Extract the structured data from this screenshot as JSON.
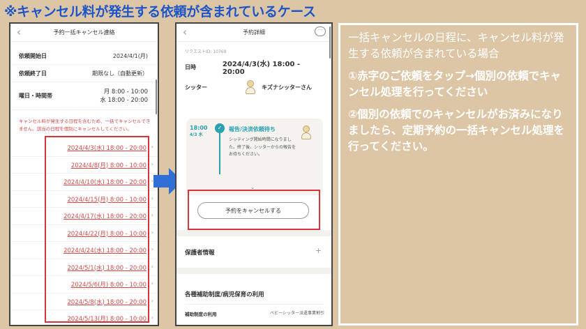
{
  "slide_title": "※キャンセル料が発生する依頼が含まれているケース",
  "left_screen": {
    "nav_title": "予約一括キャンセル連絡",
    "back_icon": "‹",
    "start_label": "依頼開始日",
    "start_value": "2024/4/1(月)",
    "end_label": "依頼終了日",
    "end_value": "期限なし（自動更新）",
    "schedule_label": "曜日・時間帯",
    "schedule_line1": "月 8:00 - 10:00",
    "schedule_line2": "水 18:00 - 20:00",
    "notice": "キャンセル料が発生する日程を含むため、一括でキャンセルできません。該当の日程を個別にキャンセルしてください。",
    "dates": [
      "2024/4/3(水) 18:00 - 20:00",
      "2024/4/8(月) 8:00 - 10:00",
      "2024/4/10(水) 18:00 - 20:00",
      "2024/4/15(月) 8:00 - 10:00",
      "2024/4/17(水) 18:00 - 20:00",
      "2024/4/22(月) 8:00 - 10:00",
      "2024/4/24(水) 18:00 - 20:00",
      "2024/5/1(水) 18:00 - 20:00",
      "2024/5/6(月) 8:00 - 10:00",
      "2024/5/8(水) 18:00 - 20:00",
      "2024/5/13(月) 8:00 - 10:00"
    ],
    "chevron": "›"
  },
  "right_screen": {
    "nav_title": "予約詳細",
    "back_icon": "‹",
    "chat_icon": "···",
    "request_id": "リクエストID: 10769",
    "datetime_label": "日時",
    "datetime_value": "2024/4/3(水) 18:00 - 20:00",
    "sitter_label": "シッター",
    "sitter_name": "キズナシッターさん",
    "timeline_time": "18:00",
    "timeline_date": "4/3 水",
    "timeline_status": "報告/決済依頼待ち",
    "timeline_message": "シッティング開始時間になりました。終了後、シッターからの報告をお待ちください。",
    "timeline_more": "⌄",
    "cancel_button": "予約をキャンセルする",
    "guardian_section": "保護者情報",
    "plus_icon": "+",
    "subsidy_section": "各種補助制度/病児保育の利用",
    "subsidy_label": "補助制度の利用",
    "subsidy_value": "ベビーシッター派遣事業割引"
  },
  "explanation": {
    "intro": "一括キャンセルの日程に、キャンセル料が発生する依頼が含まれている場合",
    "step1": "①赤字のご依頼をタップ→個別の依頼でキャンセル処理を行ってください",
    "step2": "②個別の依頼でのキャンセルがお済みになりましたら、定期予約の一括キャンセル処理を行ってください。"
  },
  "colors": {
    "background": "#ddc6a6",
    "title_blue": "#1c55c8",
    "highlight_red": "#d9333a",
    "link_red": "#d44848",
    "arrow_blue": "#2f6fd6",
    "teal": "#2aa1b3"
  }
}
